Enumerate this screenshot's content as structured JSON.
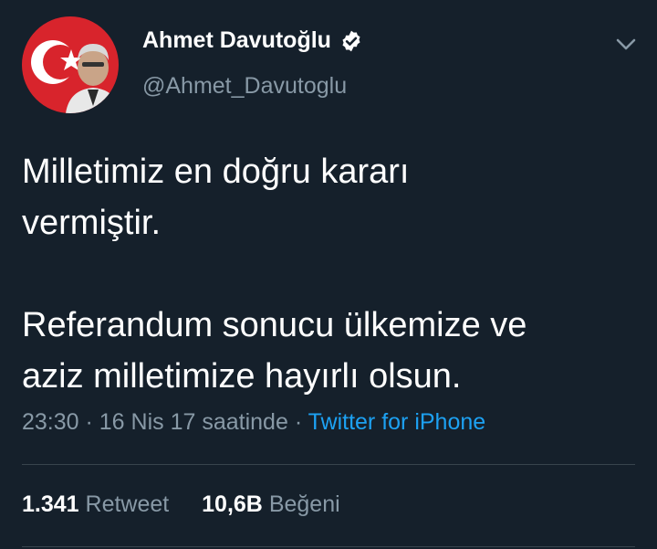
{
  "author": {
    "name": "Ahmet Davutoğlu",
    "handle": "@Ahmet_Davutoglu",
    "verified": true,
    "avatar_icon": "profile-photo-with-turkish-flag"
  },
  "menu_icon": "chevron-down-icon",
  "tweet": {
    "paragraph1_line1": "Milletimiz en doğru kararı",
    "paragraph1_line2": "vermiştir.",
    "paragraph2_line1": "Referandum sonucu ülkemize ve",
    "paragraph2_line2": "aziz milletimize hayırlı olsun."
  },
  "meta": {
    "time": "23:30",
    "separator": " · ",
    "date": "16 Nis 17 saatinde",
    "source": "Twitter for iPhone"
  },
  "stats": {
    "retweets": "1.341",
    "retweets_label": "Retweet",
    "likes": "10,6B",
    "likes_label": "Beğeni"
  },
  "colors": {
    "background": "#15202b",
    "secondary_text": "#8899a6",
    "link": "#1da1f2",
    "divider": "#38444d"
  }
}
